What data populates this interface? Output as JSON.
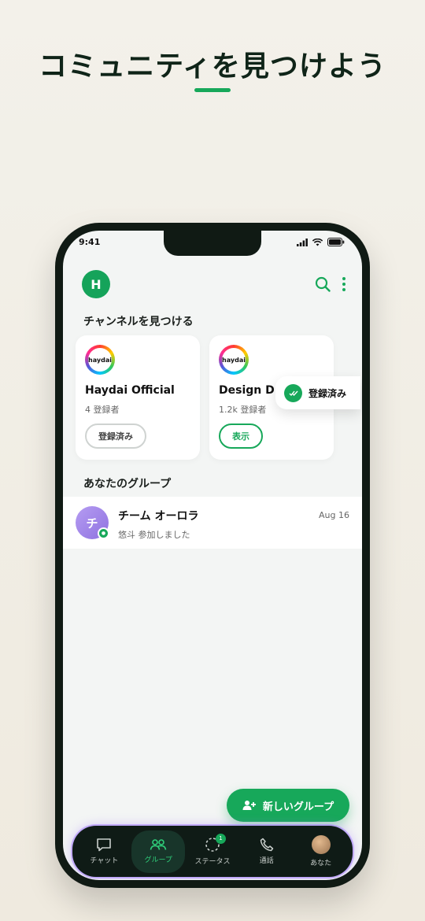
{
  "headline": "コミュニティを見つけよう",
  "status": {
    "time": "9:41"
  },
  "profile": {
    "initial": "H"
  },
  "channels": {
    "title": "チャンネルを見つける",
    "cards": [
      {
        "logo": "haydai",
        "name": "Haydai Official",
        "subscribers": "4 登録者",
        "button": "登録済み"
      },
      {
        "logo": "haydai",
        "name": "Design D",
        "subscribers": "1.2k 登録者",
        "button": "表示"
      }
    ]
  },
  "toast": {
    "text": "登録済み"
  },
  "groups": {
    "title": "あなたのグループ",
    "items": [
      {
        "avatar": "チ",
        "name": "チーム オーロラ",
        "last_message": "悠斗 参加しました",
        "date": "Aug 16"
      }
    ]
  },
  "fab": {
    "label": "新しいグループ"
  },
  "nav": {
    "items": [
      {
        "label": "チャット",
        "icon": "chat-icon"
      },
      {
        "label": "グループ",
        "icon": "group-icon",
        "active": true
      },
      {
        "label": "ステータス",
        "icon": "status-icon",
        "badge": "1"
      },
      {
        "label": "通話",
        "icon": "phone-icon"
      },
      {
        "label": "あなた",
        "icon": "avatar"
      }
    ]
  },
  "colors": {
    "accent": "#17a85a",
    "navbar": "#0f1b16",
    "glow": "#a882ff"
  }
}
